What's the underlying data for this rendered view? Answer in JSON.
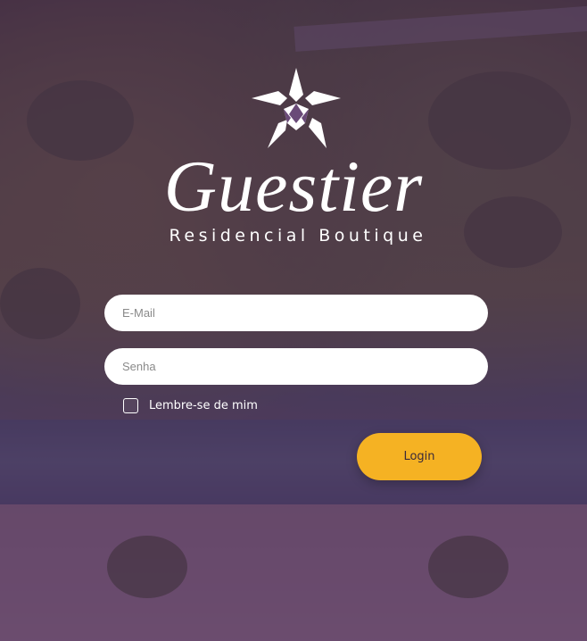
{
  "brand": {
    "name": "Guestier",
    "tagline": "Residencial Boutique",
    "logo_icon": "star-logo-icon"
  },
  "form": {
    "email_placeholder": "E-Mail",
    "email_value": "",
    "password_placeholder": "Senha",
    "password_value": "",
    "remember_label": "Lembre-se de mim",
    "remember_checked": false,
    "login_label": "Login"
  },
  "colors": {
    "overlay": "#482652",
    "accent": "#f5b223",
    "text": "#ffffff"
  }
}
